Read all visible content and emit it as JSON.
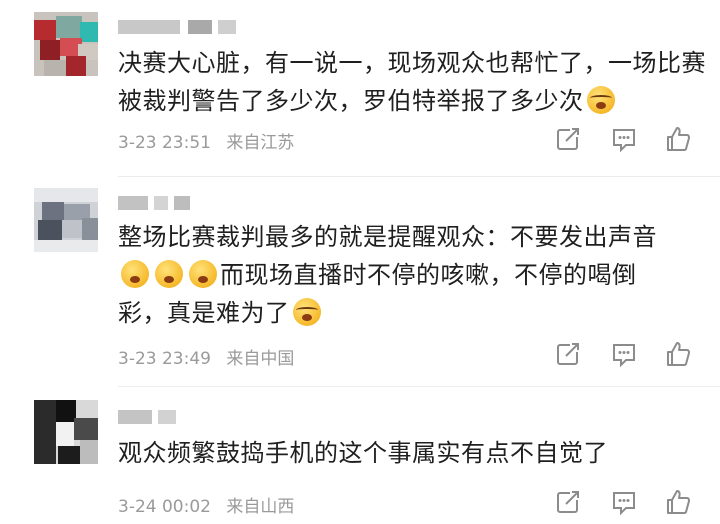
{
  "comments": [
    {
      "content_parts": [
        "决赛大心脏，有一说一，现场观众也帮忙了，一场比赛被裁判警告了多少次，罗伯特举报了多少次"
      ],
      "end_emoji": "laugh-cry-emoji",
      "date": "3-23 23:51",
      "location": "来自江苏"
    },
    {
      "content_line1": "整场比赛裁判最多的就是提醒观众：不要发出声音",
      "content_line2": "而现场直播时不停的咳嗽，不停的喝倒",
      "content_line3": "彩，真是难为了",
      "date": "3-23 23:49",
      "location": "来自中国"
    },
    {
      "content": "观众频繁鼓捣手机的这个事属实有点不自觉了",
      "date": "3-24 00:02",
      "location": "来自山西"
    }
  ],
  "icons": {
    "share": "share-icon",
    "comment": "comment-icon",
    "like": "like-icon"
  }
}
